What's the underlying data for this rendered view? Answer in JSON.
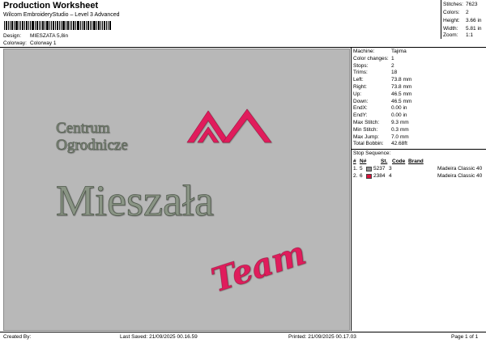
{
  "header": {
    "title": "Production Worksheet",
    "subtitle": "Wilcom EmbroideryStudio – Level 3 Advanced",
    "design_label": "Design:",
    "design_value": "MIESZATA 5,8in",
    "colorway_label": "Colorway:",
    "colorway_value": "Colorway 1"
  },
  "summary": {
    "stitches_label": "Stitches:",
    "stitches": "7623",
    "colors_label": "Colors:",
    "colors": "2",
    "height_label": "Height:",
    "height": "3.66 in",
    "width_label": "Width:",
    "width": "5.81 in",
    "zoom_label": "Zoom:",
    "zoom": "1:1"
  },
  "design_text": {
    "line1": "Centrum",
    "line2": "Ogrodnicze",
    "main": "Mieszała",
    "script": "Team"
  },
  "colors": {
    "gray_thread": "#7d8878",
    "pink_thread": "#e01f5b",
    "swatch1": "#8f8f8f",
    "swatch2": "#d9143d"
  },
  "machine_info": [
    {
      "label": "Machine:",
      "value": "Tajima"
    },
    {
      "label": "Color changes:",
      "value": "1"
    },
    {
      "label": "Stops:",
      "value": "2"
    },
    {
      "label": "Trims:",
      "value": "18"
    },
    {
      "label": "Left:",
      "value": "73.8 mm"
    },
    {
      "label": "Right:",
      "value": "73.8 mm"
    },
    {
      "label": "Up:",
      "value": "46.5 mm"
    },
    {
      "label": "Down:",
      "value": "46.5 mm"
    },
    {
      "label": "EndX:",
      "value": "0.00 in"
    },
    {
      "label": "EndY:",
      "value": "0.00 in"
    },
    {
      "label": "Max Stitch:",
      "value": "9.3 mm"
    },
    {
      "label": "Min Stitch:",
      "value": "0.3 mm"
    },
    {
      "label": "Max Jump:",
      "value": "7.0 mm"
    },
    {
      "label": "Total Bobbin:",
      "value": "42.68ft"
    }
  ],
  "stop_sequence": {
    "title": "Stop Sequence:",
    "headers": [
      "#",
      "N#",
      "St.",
      "Code",
      "Brand"
    ],
    "rows": [
      {
        "num": "1.",
        "n": "5",
        "st": "5237",
        "code": "3",
        "brand": "Madeira Classic 40"
      },
      {
        "num": "2.",
        "n": "6",
        "st": "2384",
        "code": "4",
        "brand": "Madeira Classic 40"
      }
    ]
  },
  "footer": {
    "created_by": "Created By:",
    "last_saved": "Last Saved: 21/09/2025 00.16.59",
    "printed": "Printed: 21/09/2025 00.17.03",
    "page": "Page 1 of 1"
  }
}
